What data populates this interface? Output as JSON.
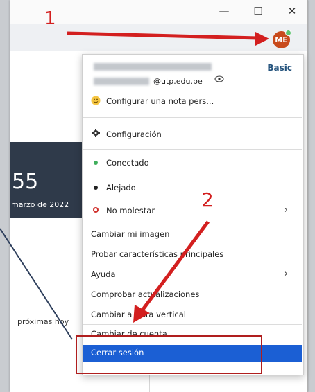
{
  "window": {
    "minimize": "—",
    "maximize": "☐",
    "close": "✕"
  },
  "avatar": {
    "initials": "ME",
    "status_color": "#5cc36f"
  },
  "background": {
    "tile_number": "55",
    "tile_date": "marzo de 2022",
    "upcoming_label": "próximas hoy"
  },
  "menu": {
    "plan": "Basic",
    "email": "@utp.edu.pe",
    "note": "Configurar una nota pers...",
    "settings": "Configuración",
    "status_items": [
      {
        "label": "Conectado",
        "color": "#3fae5c"
      },
      {
        "label": "Alejado",
        "color": "#222222"
      },
      {
        "label": "No molestar",
        "color": "#d0312d"
      }
    ],
    "change_image": "Cambiar mi imagen",
    "try_features": "Probar características principales",
    "help": "Ayuda",
    "check_updates": "Comprobar actualizaciones",
    "vertical_view": "Cambiar a vista vertical",
    "switch_account": "Cambiar de cuenta",
    "sign_out": "Cerrar sesión"
  },
  "annotations": {
    "step1": "1",
    "step2": "2",
    "color": "#d31f1f"
  }
}
